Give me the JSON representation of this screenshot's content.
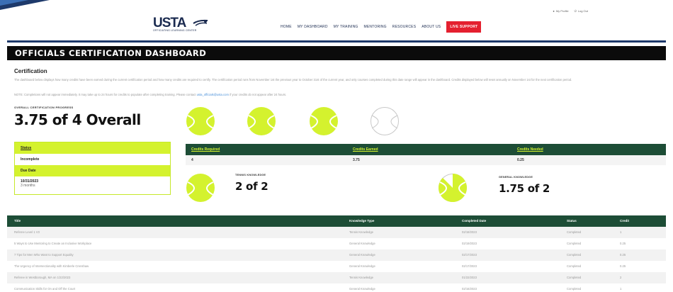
{
  "header": {
    "top_links": [
      "My Profile",
      "Log Out"
    ],
    "logo_text": "USTA",
    "logo_sub": "OFFICIATING LEARNING CENTER",
    "nav": [
      "HOME",
      "MY DASHBOARD",
      "MY TRAINING",
      "MENTORING",
      "RESOURCES",
      "ABOUT US"
    ],
    "live_button": "LIVE SUPPORT"
  },
  "page_title": "OFFICIALS CERTIFICATION DASHBOARD",
  "certification": {
    "heading": "Certification",
    "description": "The dashboard below displays how many credits have been earned during the current certification period and how many credits are required to certify. The certification period runs from November 1st the previous year to October 31st of the current year, and only courses completed during this date range will appear in the dashboard. Credits displayed below will reset annually on November 1st for the next certification period.",
    "note_prefix": "NOTE: Completions will not appear immediately. It may take up to 24 hours for credits to populate after completing training. Please contact",
    "note_email": "usta_officials@usta.com",
    "note_suffix": "if your credits do not appear after 24 hours.",
    "progress_label": "OVERALL CERTIFICATION PROGRESS",
    "overall": "3.75 of 4 Overall",
    "balls": [
      "full",
      "full",
      "full",
      "empty"
    ]
  },
  "status_box": {
    "status_label": "Status",
    "status_value": "Incomplete",
    "due_label": "Due Date",
    "due_date": "10/31/2023",
    "due_sub": "3 months"
  },
  "credits": {
    "headers": [
      "Credits Required",
      "Credits Earned",
      "Credits Needed"
    ],
    "values": [
      "4",
      "3.75",
      "0.25"
    ]
  },
  "knowledge": {
    "tennis_label": "TENNIS KNOWLEDGE",
    "tennis_value": "2 of 2",
    "general_label": "GENERAL KNOWLEDGE",
    "general_value": "1.75 of 2",
    "general_fill_fraction": 0.875
  },
  "table": {
    "headers": [
      "Title",
      "Knowledge Type",
      "Completed Date",
      "Status",
      "Credit"
    ],
    "rows": [
      [
        "Referee Level 1 V3",
        "Tennis Knowledge",
        "02/18/2023",
        "Completed",
        "1"
      ],
      [
        "5 Ways to Use Mentoring to Create an Inclusive Workplace",
        "General Knowledge",
        "02/19/2023",
        "Completed",
        "0.25"
      ],
      [
        "7 Tips for Men Who Want to Support Equality",
        "General Knowledge",
        "02/17/2023",
        "Completed",
        "0.25"
      ],
      [
        "The Urgency of Intersectionality with Kimberle Crenshaw",
        "General Knowledge",
        "02/17/2023",
        "Completed",
        "0.25"
      ],
      [
        "Referee in Westborough, MA on 1/22/2023",
        "Tennis Knowledge",
        "01/22/2023",
        "Completed",
        "2"
      ],
      [
        "Communication Skills for On and Off the Court",
        "General Knowledge",
        "02/16/2023",
        "Completed",
        "1"
      ]
    ]
  },
  "colors": {
    "ball": "#d4f22e",
    "dark_green": "#1d4d36",
    "live_red": "#e4202f",
    "navy": "#1e3a6b"
  }
}
